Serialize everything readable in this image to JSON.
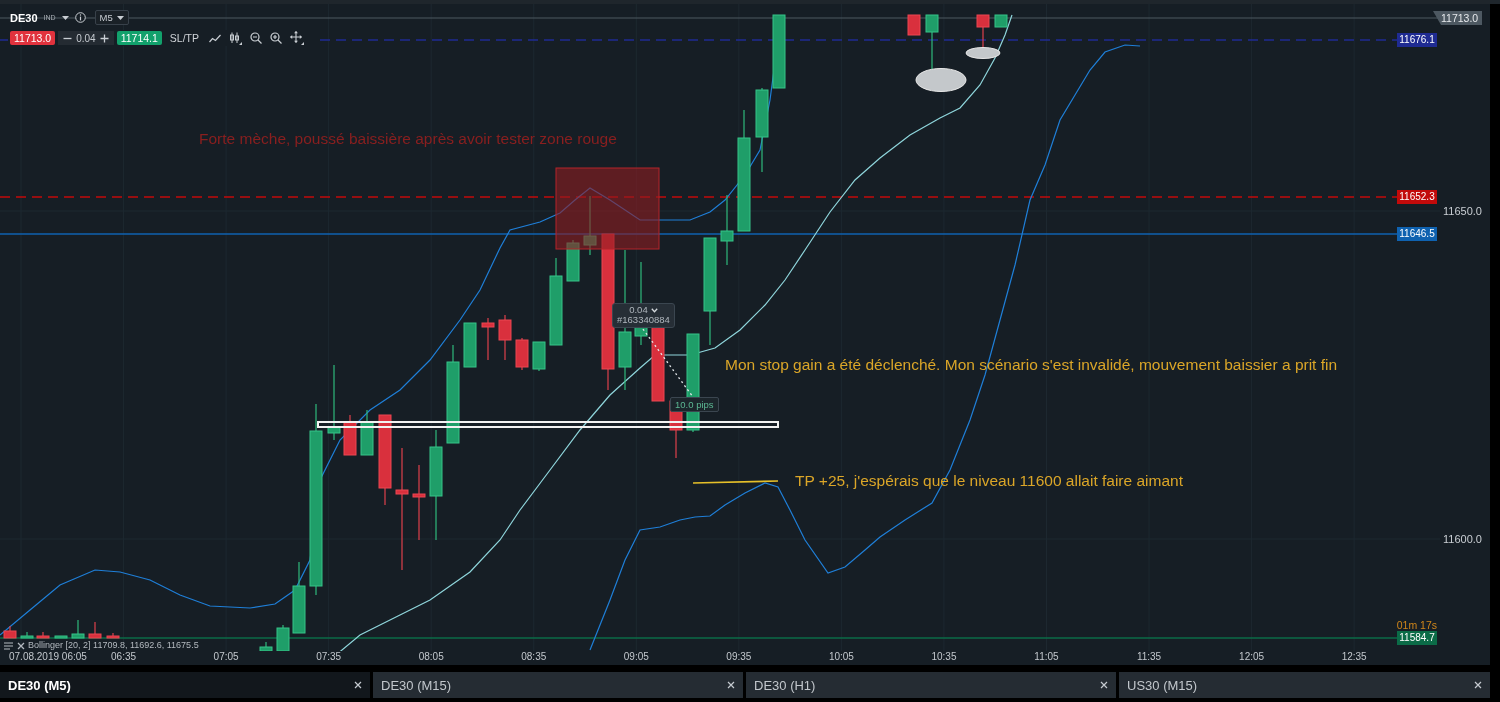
{
  "toolbar": {
    "symbol": "DE30",
    "market": "IND",
    "timeframe": "M5",
    "sell_price": "11713.0",
    "volume": "0.04",
    "buy_price": "11714.1",
    "sltp_label": "SL/TP"
  },
  "chart": {
    "annotations": [
      {
        "text": "Forte mèche, poussé baissière après avoir tester zone rouge",
        "color": "#8a1f1f"
      },
      {
        "text": "Mon stop gain a été déclenché. Mon scénario s'est invalidé, mouvement baissier a prit fin",
        "color": "#dba628"
      },
      {
        "text": "TP +25, j'espérais que le niveau 11600 allait faire aimant",
        "color": "#dba628"
      }
    ],
    "trade": {
      "volume": "0.04",
      "ticket": "#163340884",
      "distance": "10.0 pips"
    },
    "indicator_legend": "Bollinger [20, 2] 11709.8, 11692.6, 11675.5"
  },
  "price_axis": {
    "ticks": [
      "11650.0",
      "11600.0"
    ],
    "markers": [
      {
        "label": "11713.0",
        "kind": "current",
        "color": "#4d5861"
      },
      {
        "label": "11676.1",
        "kind": "dashed",
        "color": "#1f2b92"
      },
      {
        "label": "11652.3",
        "kind": "dashed",
        "color": "#c20a0a"
      },
      {
        "label": "11646.5",
        "kind": "solid",
        "color": "#0f62b0"
      },
      {
        "label": "11584.7",
        "kind": "solid",
        "color": "#0b6b47"
      }
    ],
    "countdown": "01m 17s"
  },
  "time_axis": {
    "labels": [
      "07.08.2019 06:05",
      "06:35",
      "07:05",
      "07:35",
      "08:05",
      "08:35",
      "09:05",
      "09:35",
      "10:05",
      "10:35",
      "11:05",
      "11:35",
      "12:05",
      "12:35"
    ]
  },
  "tabs": [
    {
      "label": "DE30 (M5)",
      "selected": true
    },
    {
      "label": "DE30 (M15)",
      "selected": false
    },
    {
      "label": "DE30 (H1)",
      "selected": false
    },
    {
      "label": "US30 (M15)",
      "selected": false
    }
  ]
}
